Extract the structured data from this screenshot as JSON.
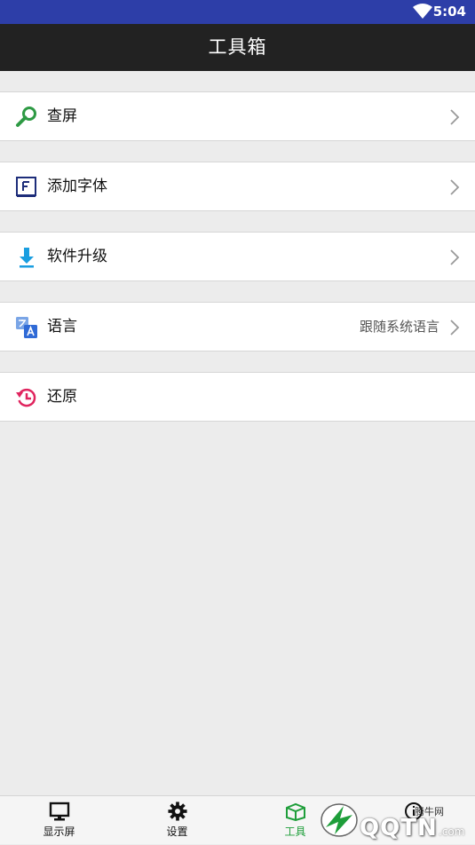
{
  "status_bar": {
    "time": "5:04"
  },
  "app_bar": {
    "title": "工具箱"
  },
  "menu": {
    "items": [
      {
        "label": "查屏",
        "icon": "search-icon",
        "chevron": true
      },
      {
        "label": "添加字体",
        "icon": "font-icon",
        "chevron": true
      },
      {
        "label": "软件升级",
        "icon": "download-icon",
        "chevron": true
      },
      {
        "label": "语言",
        "value": "跟随系统语言",
        "icon": "translate-icon",
        "chevron": true
      },
      {
        "label": "还原",
        "icon": "restore-icon",
        "chevron": false
      }
    ]
  },
  "tabbar": {
    "tabs": [
      {
        "label": "显示屏",
        "icon": "monitor-icon"
      },
      {
        "label": "设置",
        "icon": "gear-icon"
      },
      {
        "label": "工具",
        "icon": "toolbox-icon",
        "active": true
      },
      {
        "label": "",
        "icon": "about-icon"
      }
    ]
  },
  "watermark": {
    "brand": "QQTN",
    "small": "腾牛网",
    "com": ".com"
  },
  "colors": {
    "status_bar": "#2d3ea8",
    "app_bar": "#222222",
    "active_tab": "#1e9e3a"
  }
}
